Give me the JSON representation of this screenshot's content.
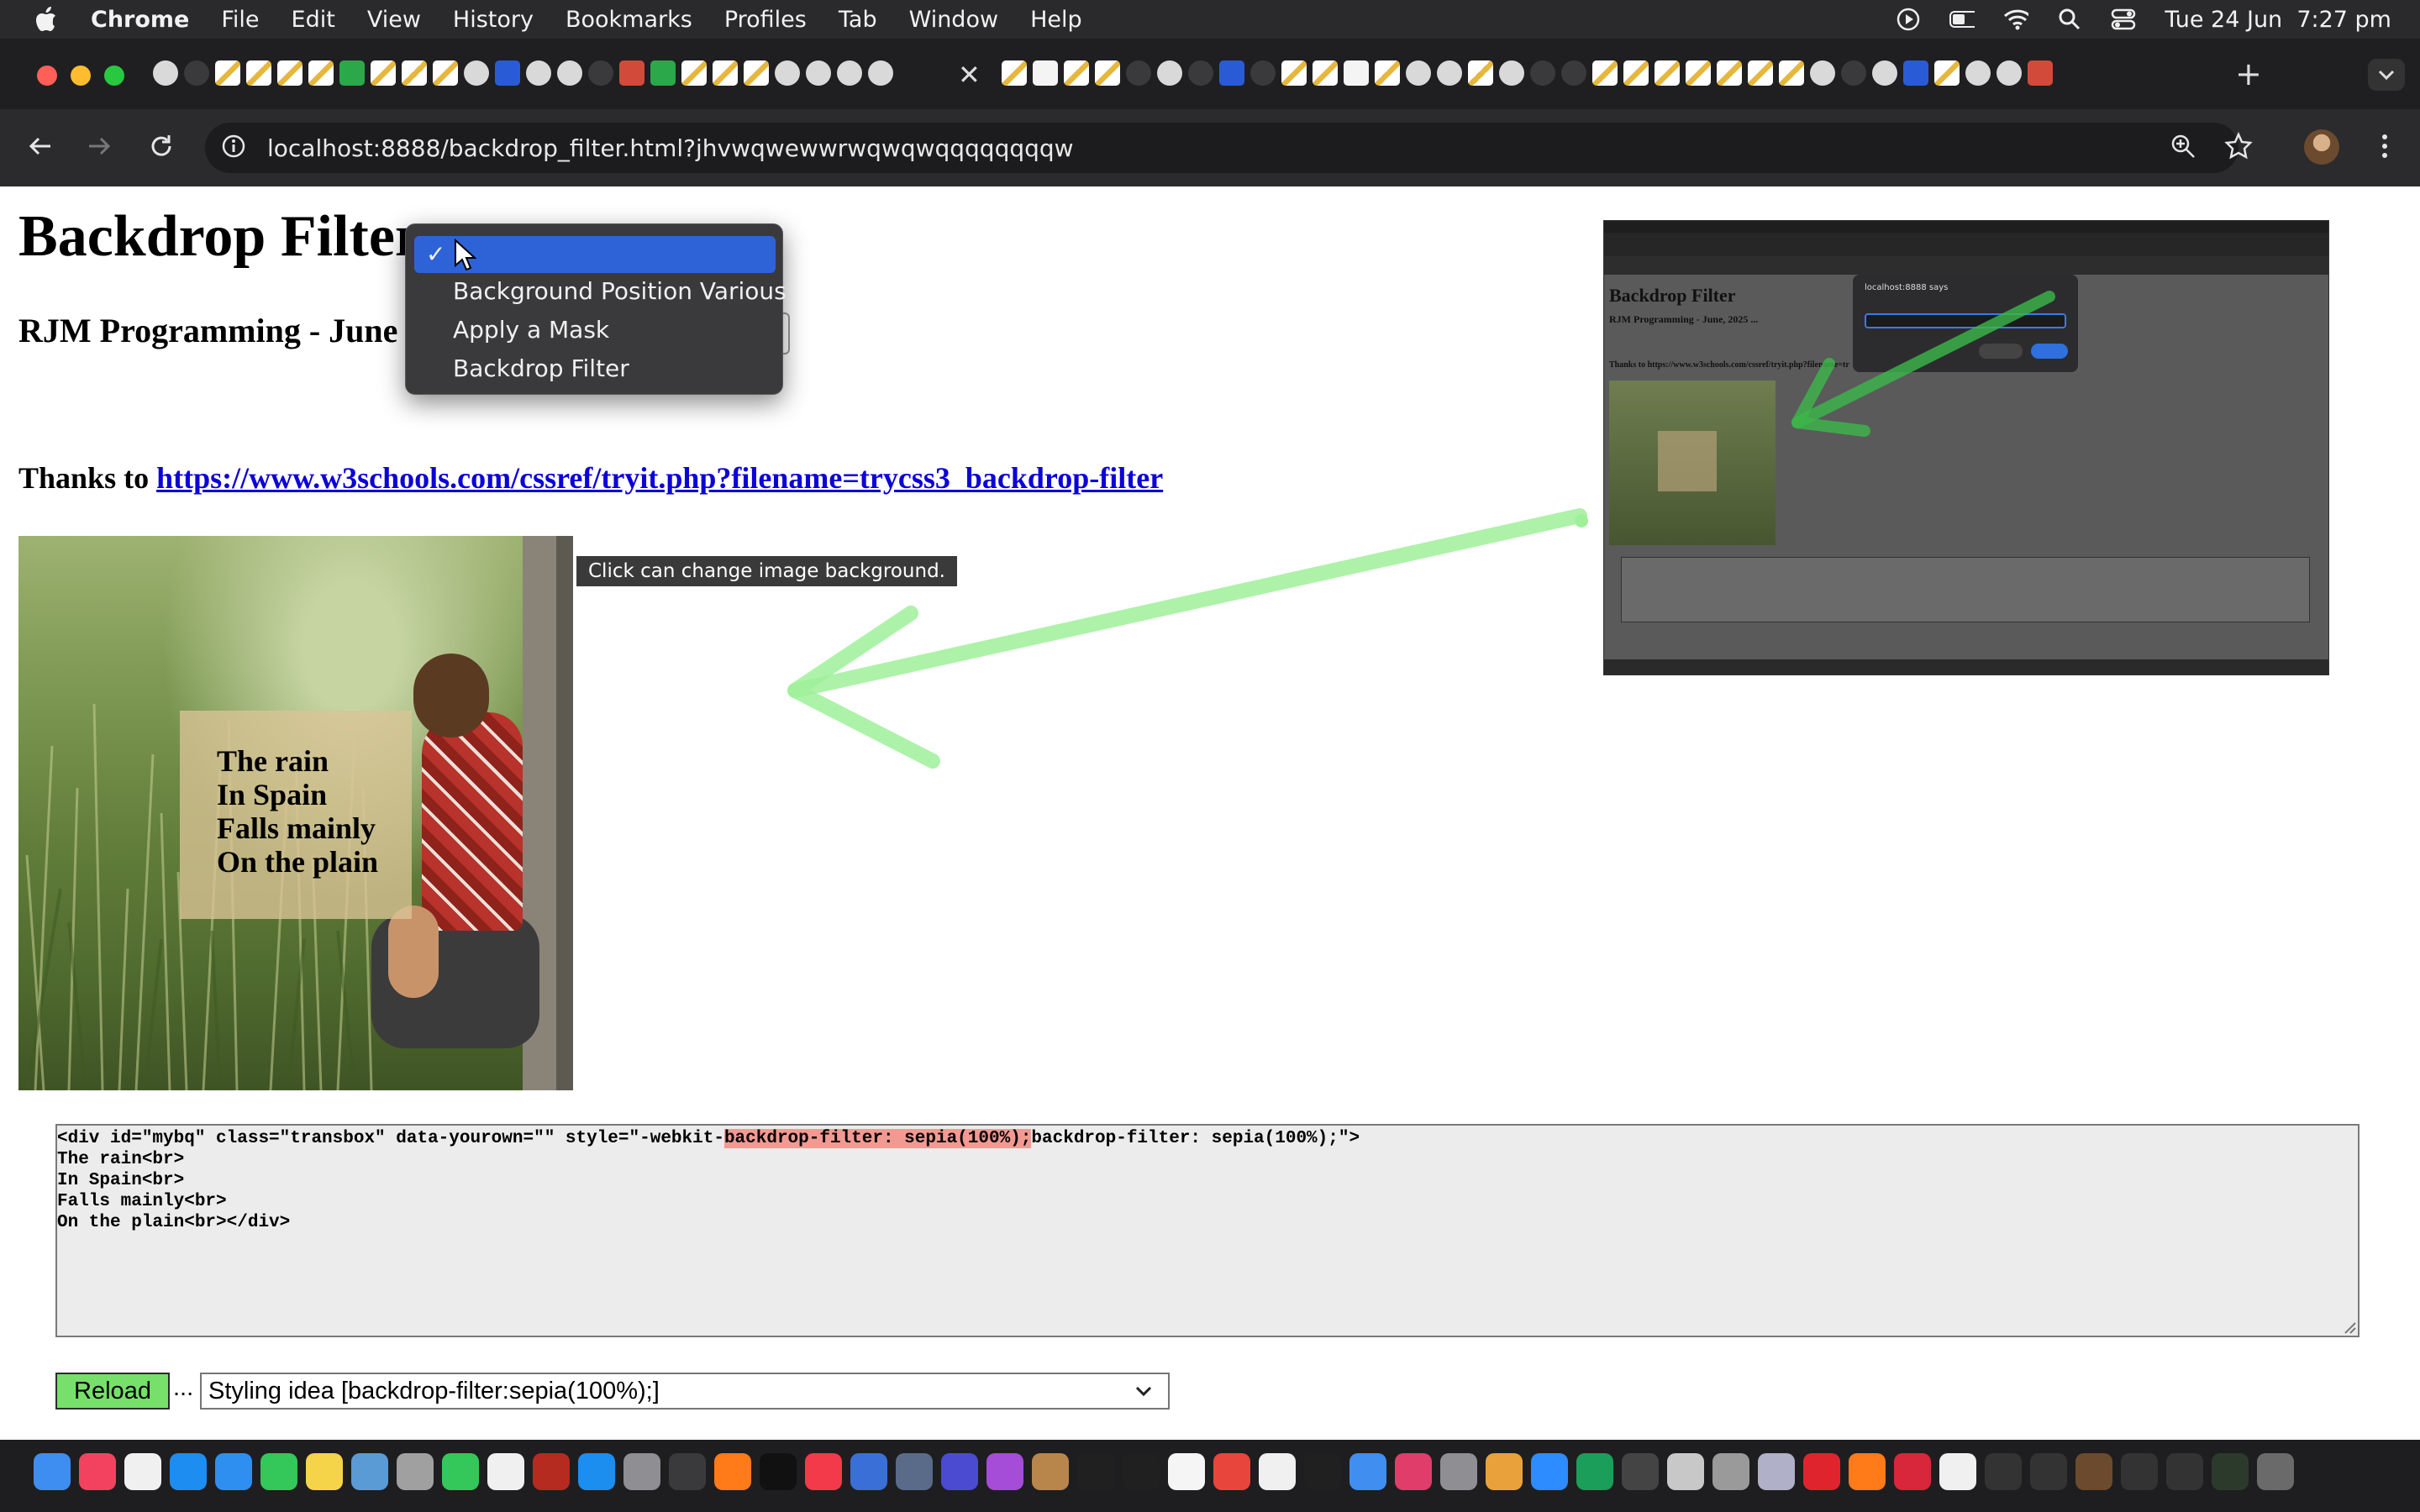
{
  "menubar": {
    "app_name": "Chrome",
    "items": [
      "File",
      "Edit",
      "View",
      "History",
      "Bookmarks",
      "Profiles",
      "Tab",
      "Window",
      "Help"
    ],
    "clock": "Tue 24 Jun  7:27 pm"
  },
  "browser": {
    "url": "localhost:8888/backdrop_filter.html?jhvwqwewwrwqwqwqqqqqqqqw",
    "tab_close_glyph": "✕",
    "new_tab_glyph": "+"
  },
  "page": {
    "title": "Backdrop Filter",
    "subtitle": "RJM Programming - June",
    "thanks_prefix": "Thanks to ",
    "thanks_link": "https://www.w3schools.com/cssref/tryit.php?filename=trycss3_backdrop-filter",
    "poem": [
      "The rain",
      "In Spain",
      "Falls mainly",
      "On the plain"
    ],
    "tooltip": "Click can change image background.",
    "code_lines": [
      {
        "pre": "<div id=\"mybq\" class=\"transbox\" data-yourown=\"\" style=\"-webkit-",
        "hl": "backdrop-filter: sepia(100%);",
        "post": "backdrop-filter: sepia(100%);\">"
      },
      {
        "pre": "The rain<br>",
        "hl": "",
        "post": ""
      },
      {
        "pre": "In Spain<br>",
        "hl": "",
        "post": ""
      },
      {
        "pre": "Falls mainly<br>",
        "hl": "",
        "post": ""
      },
      {
        "pre": "On the plain<br></div>",
        "hl": "",
        "post": ""
      }
    ],
    "reload_label": "Reload",
    "ellipsis": "...",
    "styling_select_value": "Styling idea [backdrop-filter:sepia(100%);]"
  },
  "dropdown": {
    "check_glyph": "✓",
    "options": [
      "",
      "Background Position Various",
      "Apply a Mask",
      "Backdrop Filter"
    ],
    "selected_index": 0
  },
  "preview": {
    "title": "Backdrop Filter",
    "subtitle": "RJM Programming - June, 2025 ...",
    "thanks": "Thanks to https://www.w3schools.com/cssref/tryit.php?filename=tr",
    "dialog_title": "localhost:8888 says"
  },
  "colors": {
    "accent_blue": "#2e63d8",
    "reload_green": "#76e06a",
    "code_highlight": "#f29a92",
    "link": "#0b00d8",
    "arrow_green": "#9ff09a"
  }
}
